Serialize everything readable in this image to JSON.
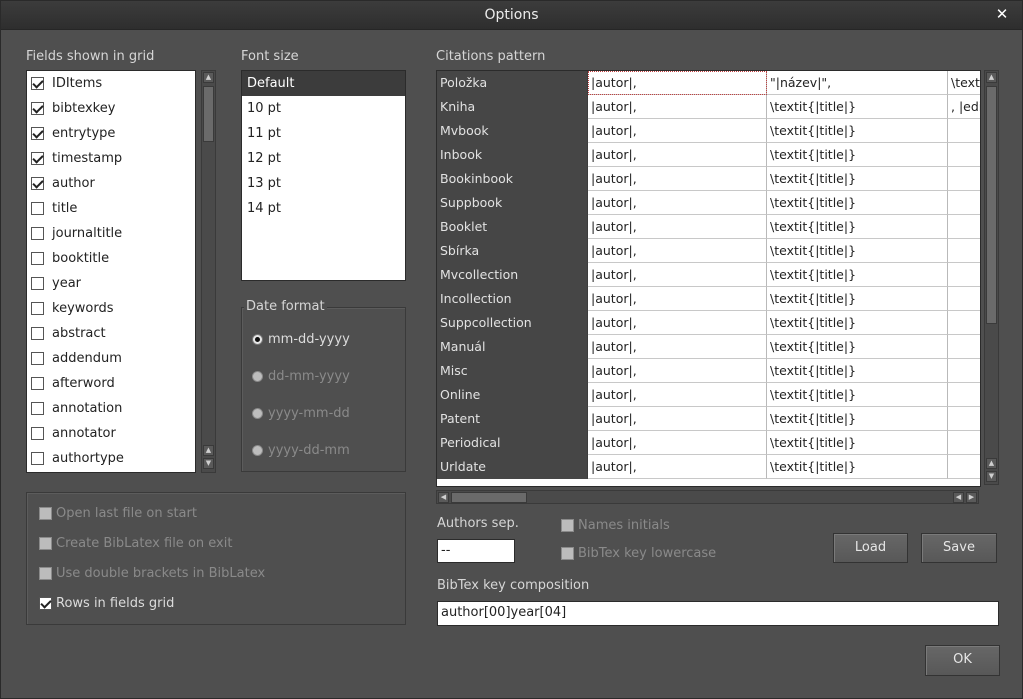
{
  "window": {
    "title": "Options"
  },
  "fields": {
    "label": "Fields shown in grid",
    "items": [
      {
        "label": "IDItems",
        "checked": true
      },
      {
        "label": "bibtexkey",
        "checked": true
      },
      {
        "label": "entrytype",
        "checked": true
      },
      {
        "label": "timestamp",
        "checked": true
      },
      {
        "label": "author",
        "checked": true
      },
      {
        "label": "title",
        "checked": false
      },
      {
        "label": "journaltitle",
        "checked": false
      },
      {
        "label": "booktitle",
        "checked": false
      },
      {
        "label": "year",
        "checked": false
      },
      {
        "label": "keywords",
        "checked": false
      },
      {
        "label": "abstract",
        "checked": false
      },
      {
        "label": "addendum",
        "checked": false
      },
      {
        "label": "afterword",
        "checked": false
      },
      {
        "label": "annotation",
        "checked": false
      },
      {
        "label": "annotator",
        "checked": false
      },
      {
        "label": "authortype",
        "checked": false
      }
    ]
  },
  "font_size": {
    "label": "Font size",
    "items": [
      "Default",
      "10 pt",
      "11 pt",
      "12 pt",
      "13 pt",
      "14 pt"
    ],
    "selected": "Default"
  },
  "date_format": {
    "label": "Date format",
    "options": [
      {
        "label": "mm-dd-yyyy",
        "checked": true,
        "enabled": true
      },
      {
        "label": "dd-mm-yyyy",
        "checked": false,
        "enabled": false
      },
      {
        "label": "yyyy-mm-dd",
        "checked": false,
        "enabled": false
      },
      {
        "label": "yyyy-dd-mm",
        "checked": false,
        "enabled": false
      }
    ]
  },
  "options": [
    {
      "label": "Open last file on start",
      "checked": false,
      "enabled": false
    },
    {
      "label": "Create BibLatex file on exit",
      "checked": false,
      "enabled": false
    },
    {
      "label": "Use double brackets in BibLatex",
      "checked": false,
      "enabled": false
    },
    {
      "label": "Rows in fields grid",
      "checked": true,
      "enabled": true
    }
  ],
  "citations": {
    "label": "Citations pattern",
    "rows": [
      {
        "name": "Položka",
        "c1": "|autor|,",
        "c2": "\"|název|\",",
        "c3": "\\texti"
      },
      {
        "name": "Kniha",
        "c1": "|autor|,",
        "c2": "\\textit{|title|}",
        "c3": ", |edi"
      },
      {
        "name": "Mvbook",
        "c1": "|autor|,",
        "c2": "\\textit{|title|}",
        "c3": ""
      },
      {
        "name": "Inbook",
        "c1": "|autor|,",
        "c2": "\\textit{|title|}",
        "c3": ""
      },
      {
        "name": "Bookinbook",
        "c1": "|autor|,",
        "c2": "\\textit{|title|}",
        "c3": ""
      },
      {
        "name": "Suppbook",
        "c1": "|autor|,",
        "c2": "\\textit{|title|}",
        "c3": ""
      },
      {
        "name": "Booklet",
        "c1": "|autor|,",
        "c2": "\\textit{|title|}",
        "c3": ""
      },
      {
        "name": "Sbírka",
        "c1": "|autor|,",
        "c2": "\\textit{|title|}",
        "c3": ""
      },
      {
        "name": "Mvcollection",
        "c1": "|autor|,",
        "c2": "\\textit{|title|}",
        "c3": ""
      },
      {
        "name": "Incollection",
        "c1": "|autor|,",
        "c2": "\\textit{|title|}",
        "c3": ""
      },
      {
        "name": "Suppcollection",
        "c1": "|autor|,",
        "c2": "\\textit{|title|}",
        "c3": ""
      },
      {
        "name": "Manuál",
        "c1": "|autor|,",
        "c2": "\\textit{|title|}",
        "c3": ""
      },
      {
        "name": "Misc",
        "c1": "|autor|,",
        "c2": "\\textit{|title|}",
        "c3": ""
      },
      {
        "name": "Online",
        "c1": "|autor|,",
        "c2": "\\textit{|title|}",
        "c3": ""
      },
      {
        "name": "Patent",
        "c1": "|autor|,",
        "c2": "\\textit{|title|}",
        "c3": ""
      },
      {
        "name": "Periodical",
        "c1": "|autor|,",
        "c2": "\\textit{|title|}",
        "c3": ""
      },
      {
        "name": "Urldate",
        "c1": "|autor|,",
        "c2": "\\textit{|title|}",
        "c3": ""
      }
    ]
  },
  "authors_sep": {
    "label": "Authors sep.",
    "value": "--"
  },
  "names_initials": {
    "label": "Names initials",
    "checked": false,
    "enabled": false
  },
  "bibtex_lowercase": {
    "label": "BibTex key lowercase",
    "checked": false,
    "enabled": false
  },
  "buttons": {
    "load": "Load",
    "save": "Save",
    "ok": "OK"
  },
  "bibtex_key": {
    "label": "BibTex key composition",
    "value": "author[00]year[04]"
  },
  "icons": {
    "close": "close-icon",
    "scroll_up": "arrow-up-icon",
    "scroll_down": "arrow-down-icon",
    "scroll_left": "arrow-left-icon",
    "scroll_right": "arrow-right-icon"
  },
  "colors": {
    "window_bg": "#4f4f4f",
    "titlebar": "#2e2e2e",
    "grid_header": "#464646",
    "selected_item": "#3c3c3c"
  }
}
